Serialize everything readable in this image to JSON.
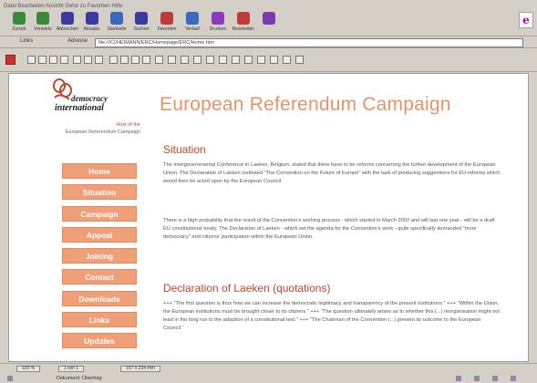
{
  "menubar": {
    "text": "Datei  Bearbeiten  Ansicht  Gehe zu  Favoriten  Hilfe"
  },
  "toolbar": {
    "buttons": [
      {
        "label": "Zurück",
        "icon": "back-arrow-icon",
        "color": "#3a8a3a"
      },
      {
        "label": "Vorwärts",
        "icon": "forward-arrow-icon",
        "color": "#3a8a3a"
      },
      {
        "label": "Abbrechen",
        "icon": "stop-icon",
        "color": "#3a3aa0"
      },
      {
        "label": "Aktualis.",
        "icon": "refresh-icon",
        "color": "#3a3aa0"
      },
      {
        "label": "Startseite",
        "icon": "home-icon",
        "color": "#3a6ac0"
      },
      {
        "label": "Suchen",
        "icon": "search-icon",
        "color": "#3a3aa0"
      },
      {
        "label": "Favoriten",
        "icon": "favorites-icon",
        "color": "#c03a3a"
      },
      {
        "label": "Verlauf",
        "icon": "history-icon",
        "color": "#3a6ac0"
      },
      {
        "label": "Drucken",
        "icon": "print-icon",
        "color": "#8a3ac0"
      },
      {
        "label": "Bearbeiten",
        "icon": "edit-icon",
        "color": "#c03a3a"
      },
      {
        "label": "",
        "icon": "discuss-icon",
        "color": "#7a3ab0"
      }
    ]
  },
  "addressbar": {
    "links_label": "Links",
    "address_label": "Adresse",
    "url": "file:///C|/HEIMANN/ERC/Homepage/ERC/Home.htm"
  },
  "page": {
    "logo_line1": "democracy",
    "logo_line2": "international",
    "tagline_highlight": "Host of the",
    "tagline_rest": "European Referendum Campaign",
    "title": "European Referendum Campaign",
    "nav": [
      "Home",
      "Situation",
      "Campaign",
      "Appeal",
      "Joining",
      "Contact",
      "Downloads",
      "Links",
      "Updates"
    ],
    "section1_heading": "Situation",
    "section1_p1": "The Intergovernmental Conference in Laeken, Belgium, stated that there have to be reforms concerning the further development of the European Union. The Declaration of Laeken instituted \"The Convention on the Future of Europe\" with the task of producing suggestions for EU-reforms which would then be acted upon by the European Council.",
    "section1_p2": "There is a high probability that the result of the Convention's working process - which started in March 2002 and will last one year - will be a draft EU constitutional treaty. The Declaration of Laeken - which set the agenda for the Convention's work - quite specifically demanded \"more democracy\" and citizens' participation within the European Union.",
    "section2_heading": "Declaration of Laeken (quotations)",
    "section2_p1": "+++ \"The first question is thus how we can increase the democratic legitimacy and transparency of the present institutions.\" +++ \"Within the Union, the European institutions must be brought closer to its citizens.\" +++ \"The question ultimately arises as to whether this (...) reorganisation might not lead in the long run to the adoption of a constitutional text.\" +++ \"The Chairman of the Convention (...) present its outcome to the European Council.\""
  },
  "statusbar": {
    "zoom": "100 %",
    "pages": "1 von 1",
    "size": "167 x 234 mm",
    "status_text": "Dokument: Übertrag"
  }
}
